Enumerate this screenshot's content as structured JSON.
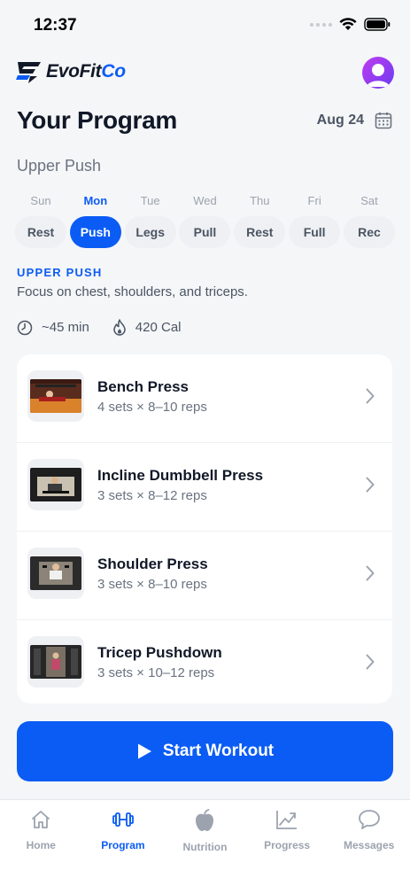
{
  "status_bar": {
    "time": "12:37"
  },
  "brand": {
    "name_main": "EvoFit",
    "name_accent": "Co",
    "accent_color": "#0b5cf5"
  },
  "header": {
    "title": "Your Program",
    "date": "Aug 24"
  },
  "program": {
    "name": "Upper Push"
  },
  "days": [
    {
      "day": "Sun",
      "label": "Rest",
      "active": false
    },
    {
      "day": "Mon",
      "label": "Push",
      "active": true
    },
    {
      "day": "Tue",
      "label": "Legs",
      "active": false
    },
    {
      "day": "Wed",
      "label": "Pull",
      "active": false
    },
    {
      "day": "Thu",
      "label": "Rest",
      "active": false
    },
    {
      "day": "Fri",
      "label": "Full",
      "active": false
    },
    {
      "day": "Sat",
      "label": "Rec",
      "active": false
    }
  ],
  "focus": {
    "title": "UPPER PUSH",
    "description": "Focus on chest, shoulders, and triceps."
  },
  "meta": {
    "duration": "~45 min",
    "calories": "420 Cal"
  },
  "exercises": [
    {
      "name": "Bench Press",
      "sets": "4 sets × 8–10 reps"
    },
    {
      "name": "Incline Dumbbell Press",
      "sets": "3 sets × 8–12 reps"
    },
    {
      "name": "Shoulder Press",
      "sets": "3 sets × 8–10 reps"
    },
    {
      "name": "Tricep Pushdown",
      "sets": "3 sets × 10–12 reps"
    }
  ],
  "start_button": {
    "label": "Start Workout"
  },
  "tabs": [
    {
      "label": "Home",
      "icon": "home-icon",
      "active": false
    },
    {
      "label": "Program",
      "icon": "dumbbell-icon",
      "active": true
    },
    {
      "label": "Nutrition",
      "icon": "apple-icon",
      "active": false
    },
    {
      "label": "Progress",
      "icon": "chart-icon",
      "active": false
    },
    {
      "label": "Messages",
      "icon": "chat-icon",
      "active": false
    }
  ]
}
